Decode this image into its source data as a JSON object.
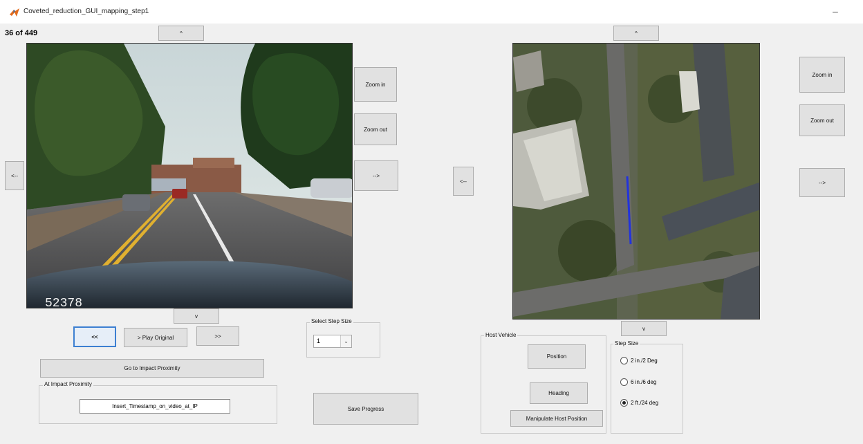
{
  "window": {
    "title": "Coveted_reduction_GUI_mapping_step1",
    "minimize": "–"
  },
  "video_panel": {
    "frame_counter": "36 of 449",
    "overlay_number": "52378",
    "pan_up": "^",
    "pan_down": "v",
    "pan_left": "<--",
    "pan_right": "-->",
    "zoom_in": "Zoom in",
    "zoom_out": "Zoom out"
  },
  "playback": {
    "back": "<<",
    "play_original": "> Play Original",
    "forward": ">>"
  },
  "impact": {
    "go_button": "Go to Impact Proximity",
    "group_label": "At Impact Proximity",
    "timestamp_field": "Insert_Timestamp_on_video_at_IP"
  },
  "step_select": {
    "label": "Select Step Size",
    "value": "1"
  },
  "save_progress": "Save Progress",
  "map_panel": {
    "pan_up": "^",
    "pan_down": "v",
    "pan_left": "<--",
    "pan_right": "-->",
    "zoom_in": "Zoom in",
    "zoom_out": "Zoom out"
  },
  "host_vehicle": {
    "label": "Host Vehicle",
    "position": "Position",
    "heading": "Heading",
    "manipulate": "Manipulate Host Position"
  },
  "step_size": {
    "label": "Step Size",
    "options": [
      {
        "label": "2 in./2 Deg",
        "selected": false
      },
      {
        "label": "6 in./6 deg",
        "selected": false
      },
      {
        "label": "2 ft./24 deg",
        "selected": true
      }
    ]
  }
}
